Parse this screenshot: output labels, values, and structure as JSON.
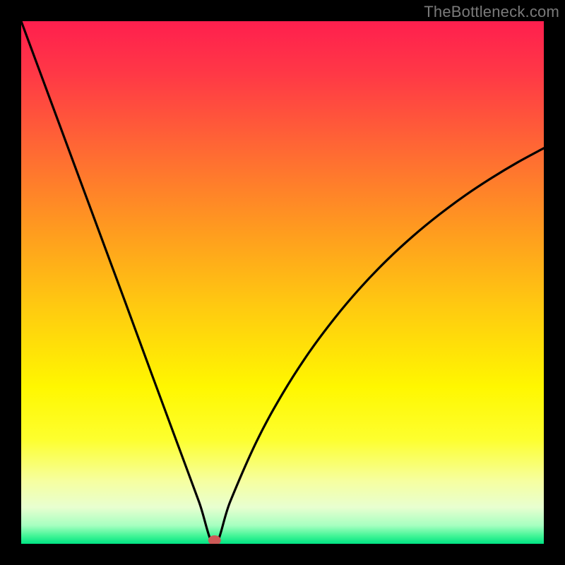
{
  "credit": "TheBottleneck.com",
  "chart_data": {
    "type": "line",
    "title": "",
    "xlabel": "",
    "ylabel": "",
    "xlim": [
      0,
      100
    ],
    "ylim": [
      0,
      100
    ],
    "grid": false,
    "x_min": 37,
    "series": [
      {
        "name": "bottleneck-curve",
        "x": [
          0,
          5,
          10,
          15,
          20,
          25,
          30,
          34,
          37,
          40,
          45,
          50,
          55,
          60,
          65,
          70,
          75,
          80,
          85,
          90,
          95,
          100
        ],
        "values": [
          100,
          86.5,
          73,
          59.5,
          46,
          32.4,
          18.9,
          8.1,
          0,
          8.1,
          19.5,
          28.7,
          36.5,
          43.2,
          49.1,
          54.3,
          58.9,
          63,
          66.7,
          70,
          73,
          75.7
        ]
      }
    ],
    "marker": {
      "x": 37,
      "y": 0
    },
    "background_gradient": {
      "stops": [
        {
          "offset": 0.0,
          "color": "#ff1f4e"
        },
        {
          "offset": 0.1,
          "color": "#ff3846"
        },
        {
          "offset": 0.25,
          "color": "#ff6a33"
        },
        {
          "offset": 0.4,
          "color": "#ff9b1f"
        },
        {
          "offset": 0.55,
          "color": "#ffcb10"
        },
        {
          "offset": 0.7,
          "color": "#fff700"
        },
        {
          "offset": 0.8,
          "color": "#fdff2e"
        },
        {
          "offset": 0.88,
          "color": "#f6ffa0"
        },
        {
          "offset": 0.93,
          "color": "#e8ffd0"
        },
        {
          "offset": 0.965,
          "color": "#a6ffc0"
        },
        {
          "offset": 0.985,
          "color": "#41f596"
        },
        {
          "offset": 1.0,
          "color": "#00e383"
        }
      ]
    }
  }
}
